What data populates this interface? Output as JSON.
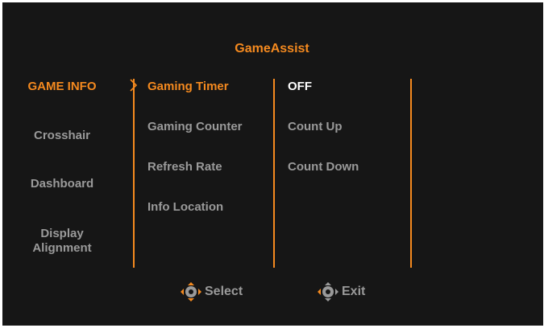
{
  "header": {
    "title": "GameAssist"
  },
  "categories": [
    {
      "label": "GAME INFO"
    },
    {
      "label": "Crosshair"
    },
    {
      "label": "Dashboard"
    },
    {
      "label": "Display\nAlignment"
    }
  ],
  "options": [
    {
      "label": "Gaming Timer"
    },
    {
      "label": "Gaming Counter"
    },
    {
      "label": "Refresh Rate"
    },
    {
      "label": "Info Location"
    }
  ],
  "values": [
    {
      "label": "OFF"
    },
    {
      "label": "Count Up"
    },
    {
      "label": "Count Down"
    }
  ],
  "footer": {
    "select_label": "Select",
    "exit_label": "Exit",
    "select_icon": "joystick-icon",
    "exit_icon": "joystick-icon"
  },
  "colors": {
    "accent": "#f58a1f",
    "background": "#161616",
    "inactive_text": "#9a9a9a",
    "selected_value": "#ffffff"
  }
}
